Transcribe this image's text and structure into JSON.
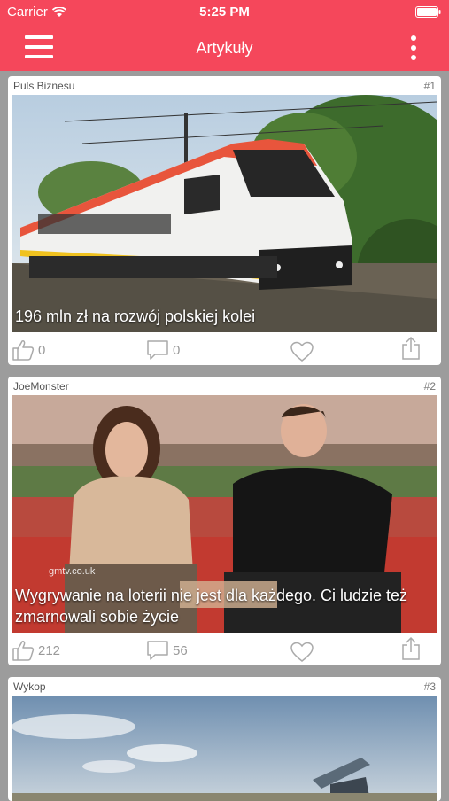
{
  "status_bar": {
    "carrier": "Carrier",
    "time": "5:25 PM"
  },
  "navbar": {
    "title": "Artykuły"
  },
  "colors": {
    "accent": "#f5475b",
    "background": "#9c9c9c"
  },
  "articles": [
    {
      "source": "Puls Biznesu",
      "rank": "#1",
      "title": "196 mln zł na rozwój polskiej kolei",
      "likes": "0",
      "comments": "0"
    },
    {
      "source": "JoeMonster",
      "rank": "#2",
      "title": "Wygrywanie na loterii nie jest dla każdego. Ci ludzie też zmarnowali sobie życie",
      "likes": "212",
      "comments": "56",
      "image_watermark": "gmtv.co.uk"
    },
    {
      "source": "Wykop",
      "rank": "#3",
      "title": "",
      "likes": "",
      "comments": ""
    }
  ],
  "icons": [
    "menu-icon",
    "more-vertical-icon",
    "wifi-icon",
    "battery-icon",
    "thumbs-up-icon",
    "comment-icon",
    "heart-icon",
    "share-icon"
  ]
}
